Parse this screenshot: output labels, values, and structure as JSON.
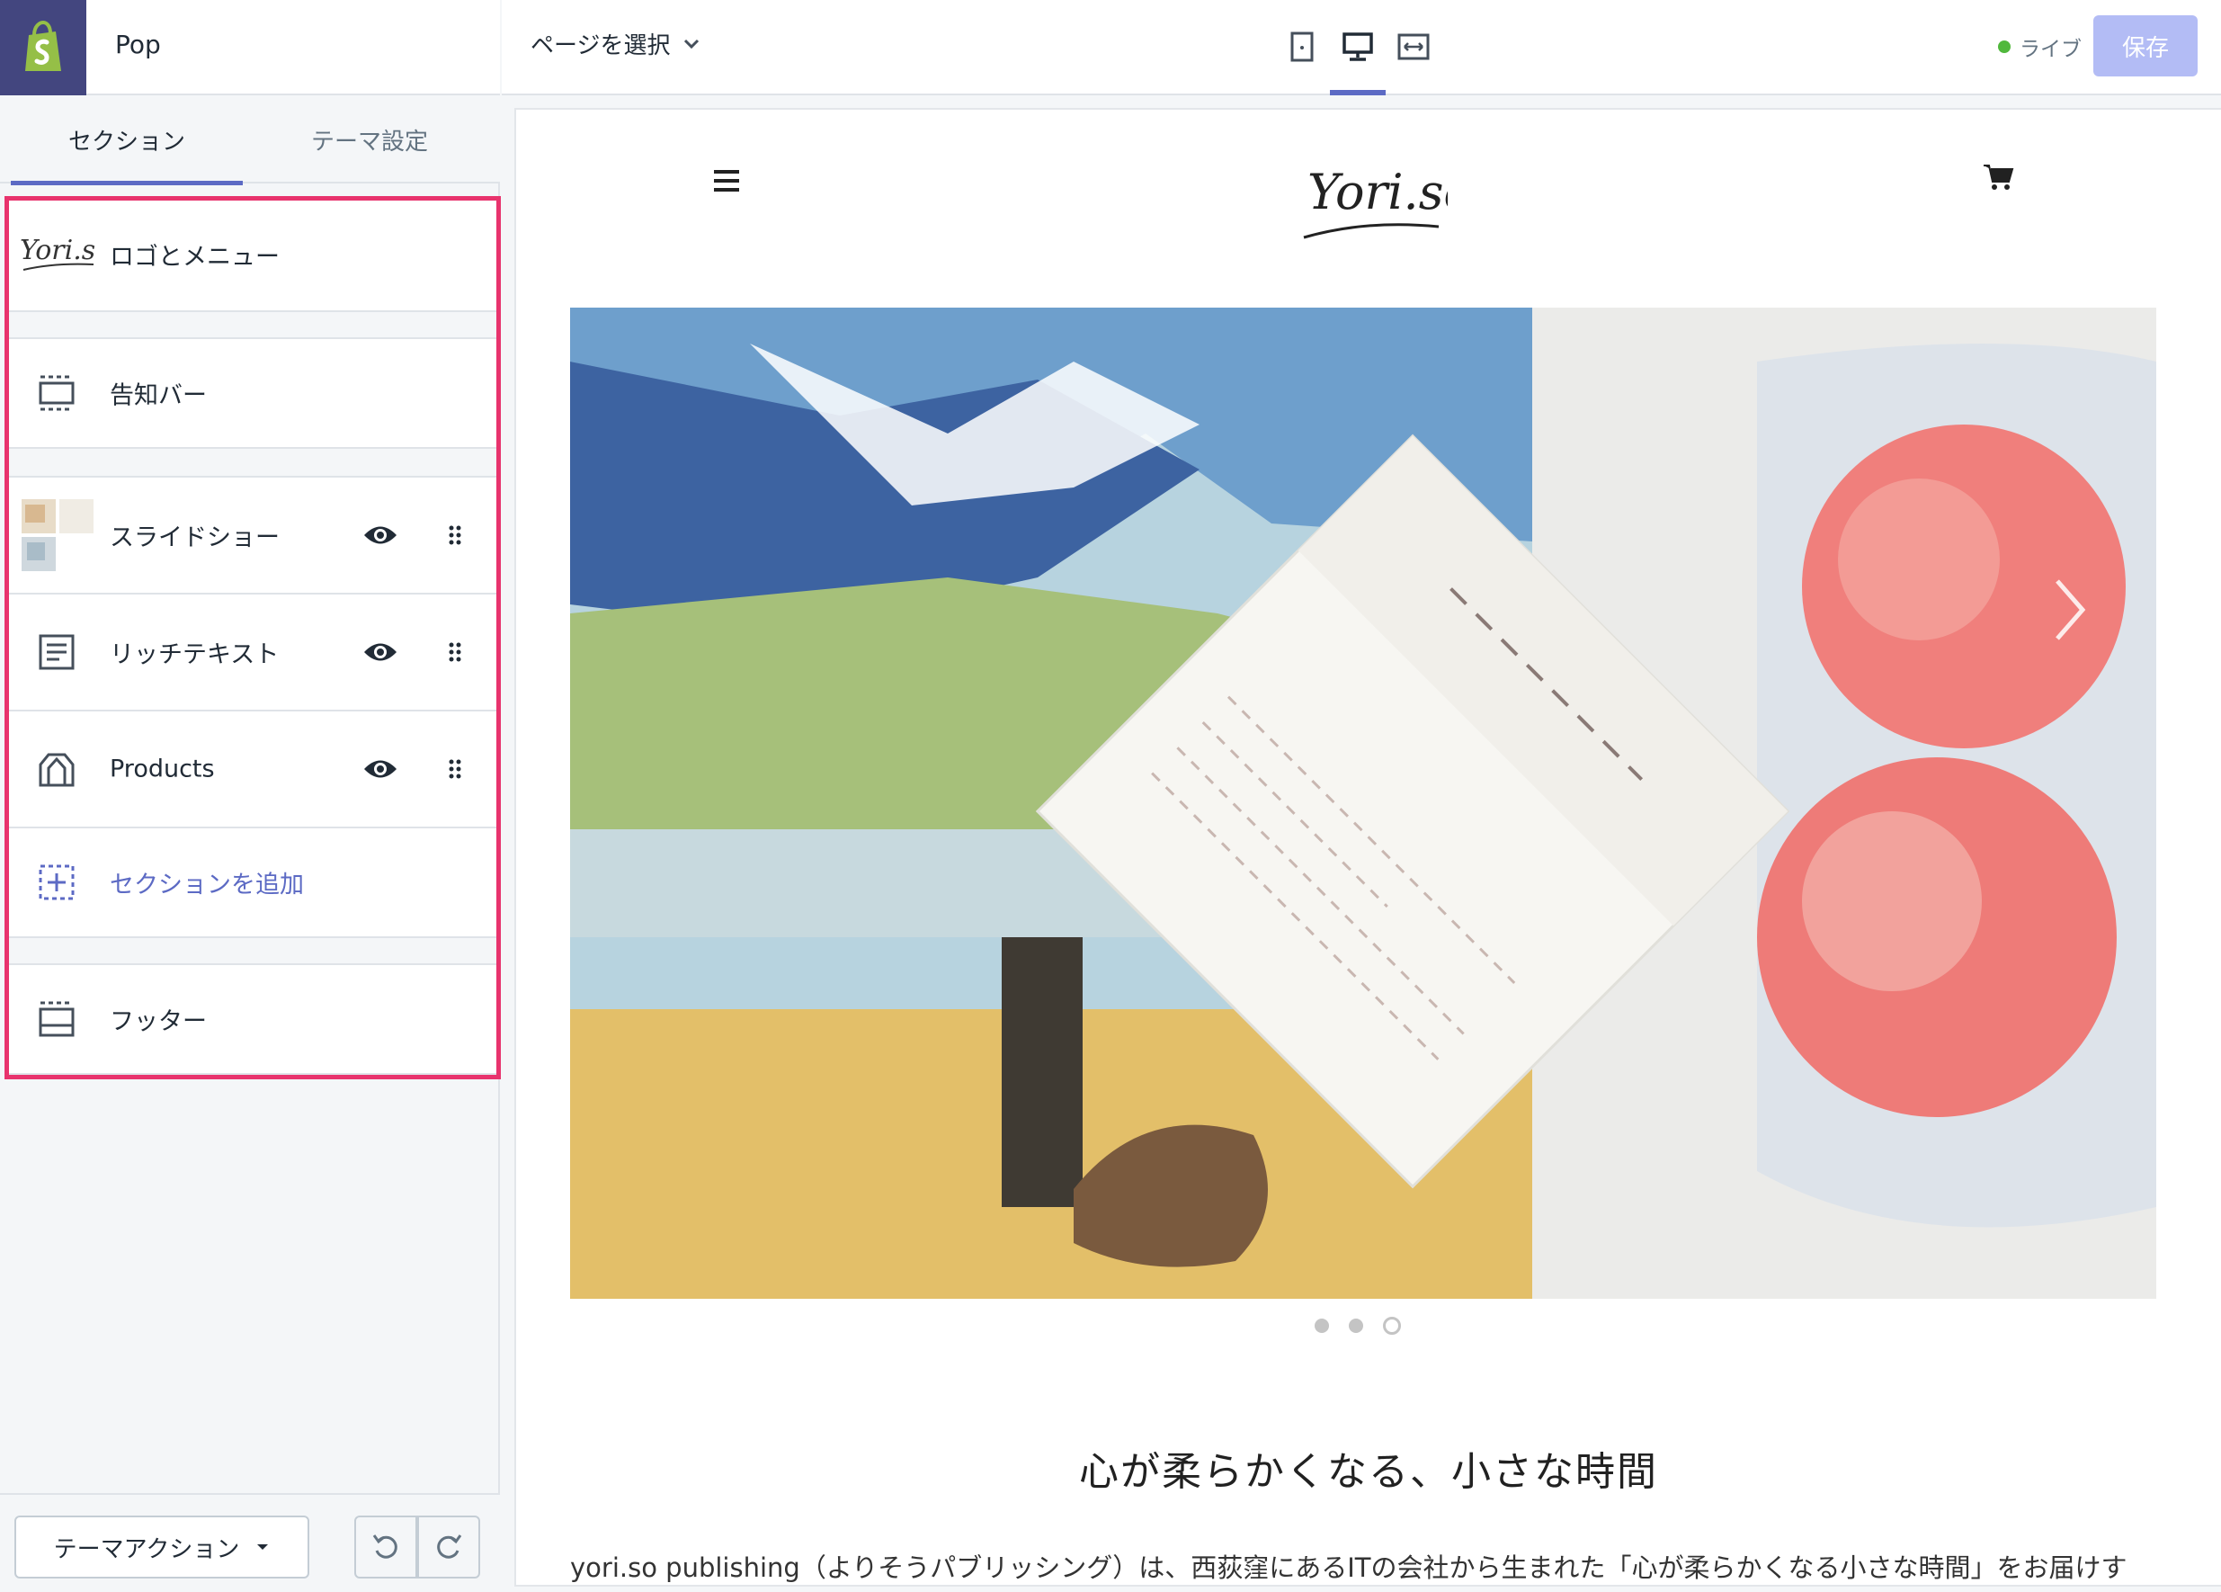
{
  "store": {
    "name": "Pop"
  },
  "sidebar": {
    "tabs": [
      {
        "label": "セクション"
      },
      {
        "label": "テーマ設定"
      }
    ],
    "sections": [
      {
        "label": "ロゴとメニュー"
      },
      {
        "label": "告知バー"
      },
      {
        "label": "スライドショー"
      },
      {
        "label": "リッチテキスト"
      },
      {
        "label": "Products"
      },
      {
        "label": "セクションを追加"
      },
      {
        "label": "フッター"
      }
    ],
    "bottom": {
      "theme_actions_label": "テーマアクション"
    }
  },
  "topbar": {
    "page_select_label": "ページを選択",
    "status_label": "ライブ",
    "save_label": "保存"
  },
  "preview": {
    "logo_text": "Yori.so",
    "slideshow": {
      "slide_count": 3,
      "active_index": 2
    },
    "rich_text": {
      "heading": "心が柔らかくなる、小さな時間",
      "body": "yori.so publishing（よりそうパブリッシング）は、西荻窪にあるITの会社から生まれた「心が柔らかくなる小さな時間」をお届けす"
    }
  },
  "colors": {
    "accent": "#5c6ac4",
    "highlight": "#e8336d",
    "live": "#50b83c",
    "shopify": "#43467f"
  }
}
